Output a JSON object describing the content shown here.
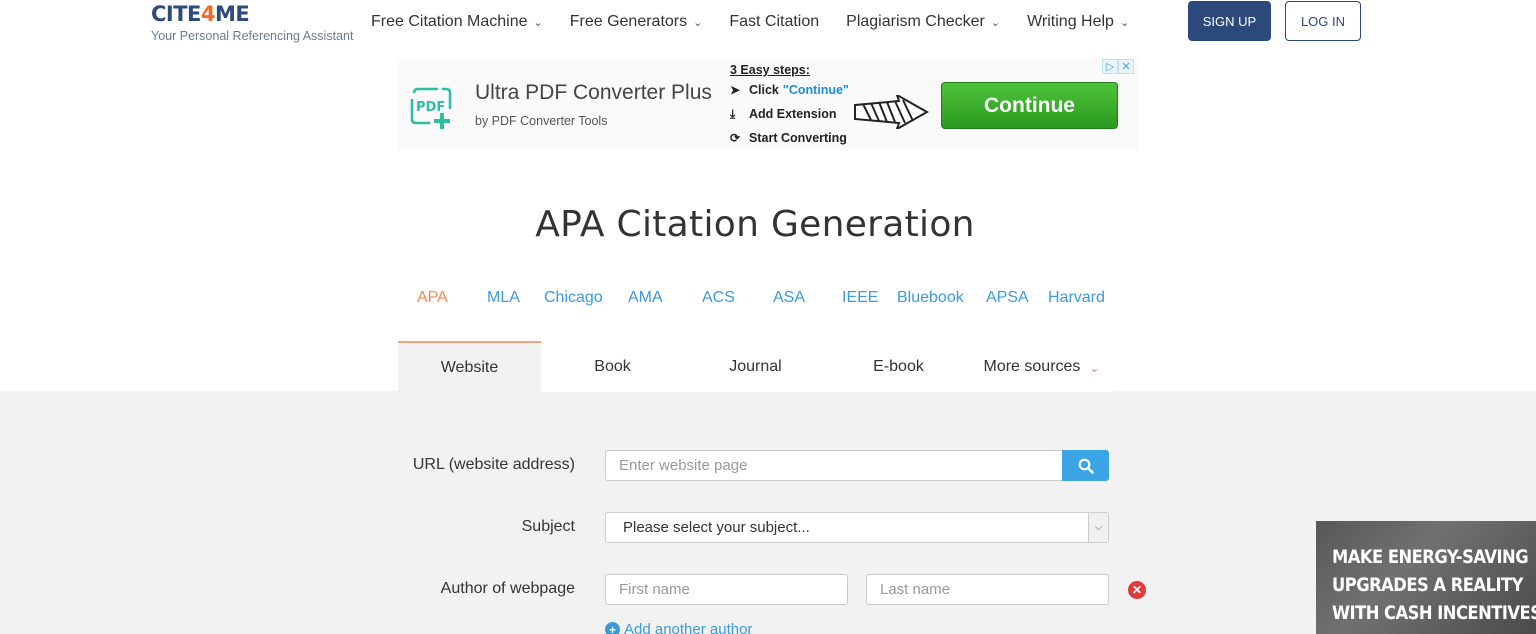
{
  "header": {
    "logo_part1": "CITE",
    "logo_part2": "4",
    "logo_part3": "ME",
    "tagline": "Your Personal Referencing Assistant",
    "nav": [
      {
        "label": "Free Citation Machine",
        "dropdown": true
      },
      {
        "label": "Free Generators",
        "dropdown": true
      },
      {
        "label": "Fast Citation",
        "dropdown": false
      },
      {
        "label": "Plagiarism Checker",
        "dropdown": true
      },
      {
        "label": "Writing Help",
        "dropdown": true
      }
    ],
    "signup_label": "SIGN UP",
    "login_label": "LOG IN"
  },
  "ad": {
    "title": "Ultra PDF Converter Plus",
    "subtitle": "by PDF Converter Tools",
    "steps_header": "3 Easy steps:",
    "step1_prefix": "Click",
    "step1_quote": "\"Continue\"",
    "step2": "Add Extension",
    "step3": "Start Converting",
    "button": "Continue",
    "icon_text": "PDF"
  },
  "page_title": "APA Citation Generation",
  "style_tabs": [
    "APA",
    "MLA",
    "Chicago",
    "AMA",
    "ACS",
    "ASA",
    "IEEE",
    "Bluebook",
    "APSA",
    "Harvard"
  ],
  "active_style": "APA",
  "source_tabs": {
    "website": "Website",
    "book": "Book",
    "journal": "Journal",
    "ebook": "E-book",
    "more": "More sources"
  },
  "form": {
    "url_label": "URL (website address)",
    "url_placeholder": "Enter website page",
    "subject_label": "Subject",
    "subject_value": "Please select your subject...",
    "author_label": "Author of webpage",
    "first_name_placeholder": "First name",
    "last_name_placeholder": "Last name",
    "add_author": "Add another author"
  },
  "side_ad": {
    "line1": "MAKE ENERGY-SAVING",
    "line2": "UPGRADES A REALITY",
    "line3": "WITH CASH INCENTIVES"
  },
  "colors": {
    "brand_navy": "#2b4a7b",
    "brand_orange": "#f36b2a",
    "link_blue": "#3d9ad8",
    "active_orange": "#f08a55",
    "ad_green": "#3aae2a",
    "search_blue": "#3aa4e6",
    "remove_red": "#e03a3a"
  },
  "icons": [
    "search-icon",
    "chevron-down-icon",
    "close-icon",
    "plus-icon",
    "pdf-plus-icon",
    "cursor-icon",
    "download-icon",
    "refresh-icon",
    "arrow-right-icon"
  ]
}
